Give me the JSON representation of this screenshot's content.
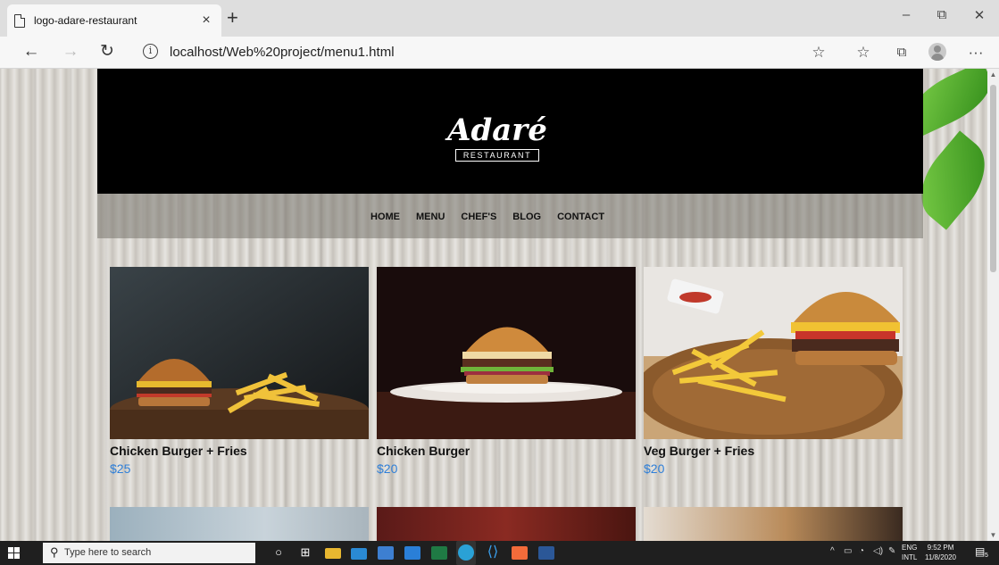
{
  "browser": {
    "tab_title": "logo-adare-restaurant",
    "tab_close": "×",
    "new_tab": "+",
    "url": "localhost/Web%20project/menu1.html",
    "window_controls": {
      "minimize": "–",
      "restore": "⧉",
      "close": "✕"
    },
    "icons": [
      "back-icon",
      "forward-icon",
      "refresh-icon",
      "info-icon",
      "favorite-star-icon",
      "favorites-icon",
      "collections-icon",
      "profile-icon",
      "more-icon"
    ]
  },
  "site": {
    "logo_main": "Adaré",
    "logo_sub": "RESTAURANT",
    "nav": [
      "HOME",
      "MENU",
      "CHEF'S",
      "BLOG",
      "CONTACT"
    ]
  },
  "menu_items": [
    {
      "name": "Chicken Burger + Fries",
      "price": "$25"
    },
    {
      "name": "Chicken Burger",
      "price": "$20"
    },
    {
      "name": "Veg Burger + Fries",
      "price": "$20"
    }
  ],
  "taskbar": {
    "search_placeholder": "Type here to search",
    "lang_top": "ENG",
    "lang_bottom": "INTL",
    "time": "9:52 PM",
    "date": "11/8/2020",
    "notification_count": "5"
  },
  "colors": {
    "price": "#2f7fd8",
    "header_bg": "#000000",
    "edge_accent": "#2aa1d6"
  }
}
